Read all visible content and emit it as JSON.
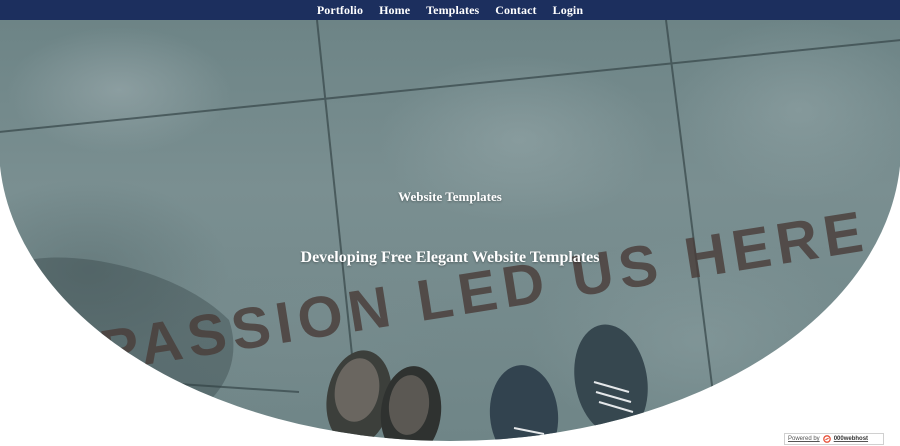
{
  "nav": {
    "items": [
      {
        "label": "Portfolio"
      },
      {
        "label": "Home"
      },
      {
        "label": "Templates"
      },
      {
        "label": "Contact"
      },
      {
        "label": "Login"
      }
    ]
  },
  "hero": {
    "subtitle": "Website Templates",
    "title": "Developing Free Elegant Website Templates",
    "background_text": "PASSION LED US HERE"
  },
  "badge": {
    "prefix": "Powered by",
    "brand": "000webhost"
  },
  "colors": {
    "nav_bg": "#1c2f5e",
    "nav_text": "#ffffff",
    "hero_text": "#ffffff",
    "accent": "#e8533b"
  }
}
